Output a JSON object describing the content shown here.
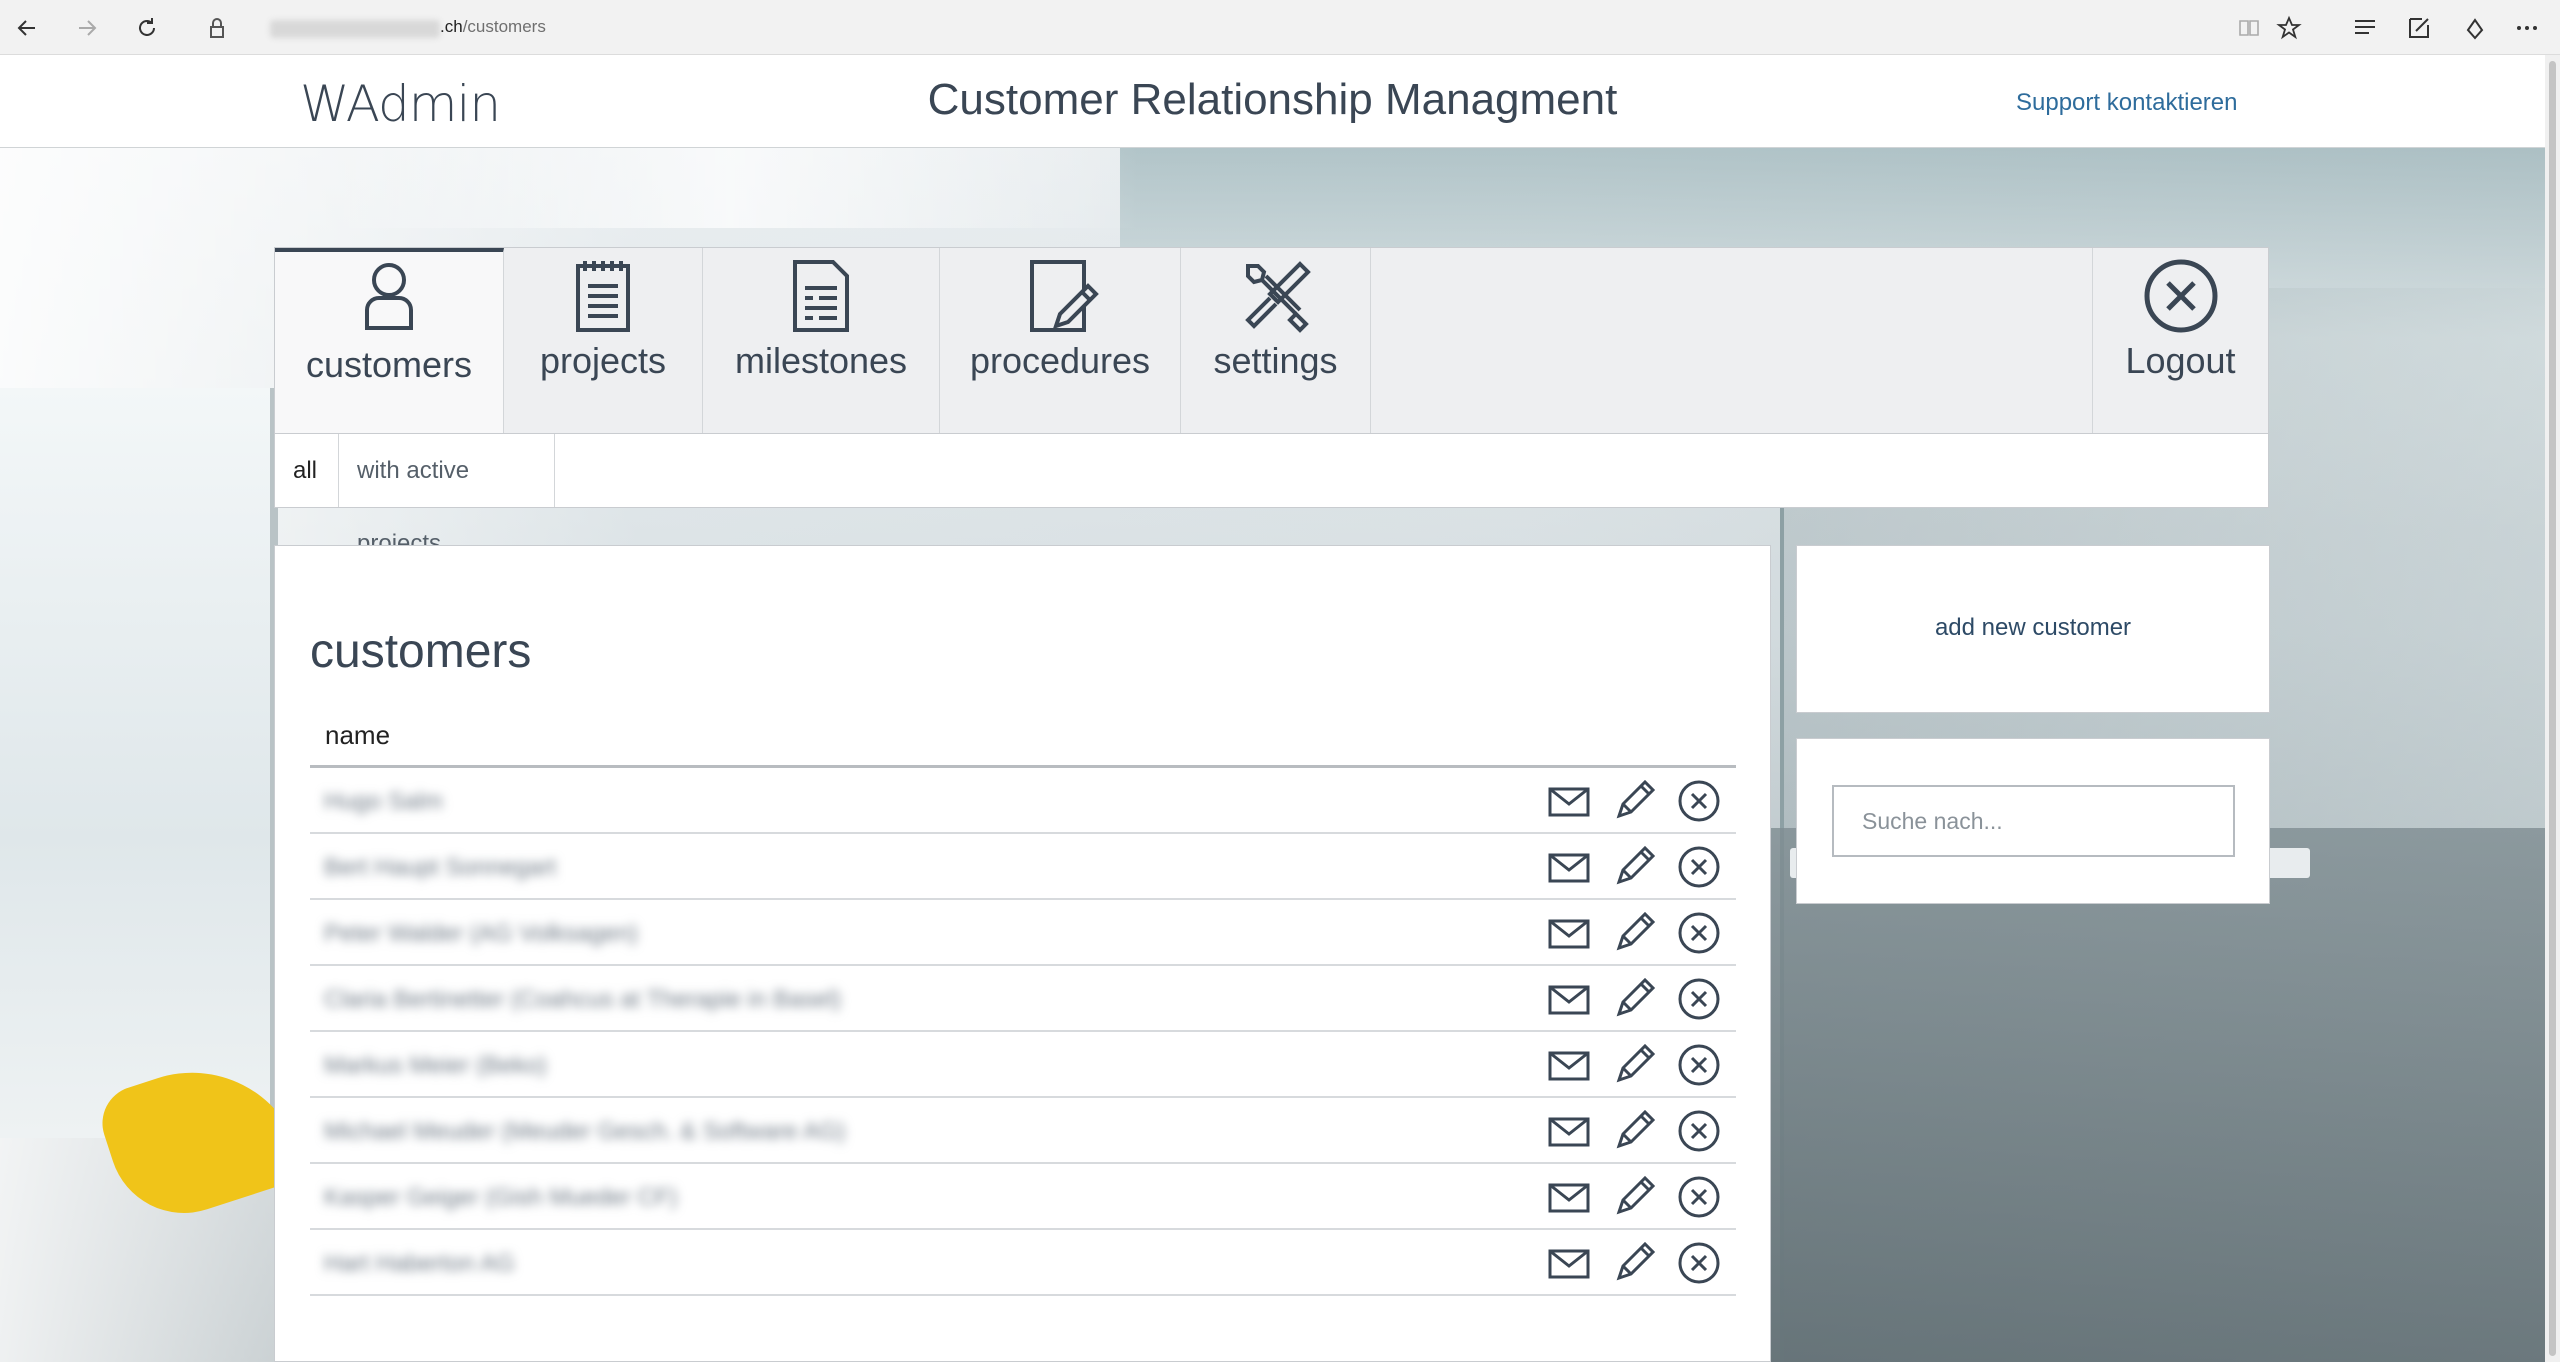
{
  "browser": {
    "url_domain": ".ch",
    "url_path": "/customers",
    "icons": [
      "back-icon",
      "forward-icon",
      "refresh-icon",
      "lock-icon",
      "reading-view-icon",
      "favorite-star-icon",
      "hub-icon",
      "web-note-icon",
      "share-icon",
      "more-icon"
    ]
  },
  "header": {
    "logo": "WAdmin",
    "title": "Customer Relationship Managment",
    "support_link": "Support kontaktieren"
  },
  "tabs": [
    {
      "label": "customers",
      "icon": "person-icon",
      "active": true
    },
    {
      "label": "projects",
      "icon": "clipboard-icon",
      "active": false
    },
    {
      "label": "milestones",
      "icon": "document-list-icon",
      "active": false
    },
    {
      "label": "procedures",
      "icon": "document-pen-icon",
      "active": false
    },
    {
      "label": "settings",
      "icon": "wrench-screwdriver-icon",
      "active": false
    }
  ],
  "logout": {
    "label": "Logout",
    "icon": "close-circle-icon"
  },
  "subtabs": [
    {
      "label": "all",
      "active": true
    },
    {
      "label": "with active projects",
      "active": false
    }
  ],
  "main": {
    "heading": "customers",
    "column_header": "name",
    "rows": [
      {
        "name": "Hugo Salm"
      },
      {
        "name": "Bert Haupt Sonnegart"
      },
      {
        "name": "Peter Walder (AG Volksagen)"
      },
      {
        "name": "Claria Bertinetter (Coahcus at Therapie in Basel)"
      },
      {
        "name": "Markus Meier (Beko)"
      },
      {
        "name": "Michael Meuder (Meuder Gesch. & Software AG)"
      },
      {
        "name": "Kasper Geiger (Gish Mueder CF)"
      },
      {
        "name": "Hart Haberton AG"
      }
    ],
    "row_action_icons": [
      "mail-icon",
      "edit-pencil-icon",
      "delete-circle-icon"
    ]
  },
  "sidebar": {
    "add_new": "add new customer",
    "search_placeholder": "Suche nach..."
  },
  "colors": {
    "primary_text": "#3a4654",
    "link": "#2e6c9c",
    "panel_bg": "#ffffff",
    "tab_bg": "#eeeff1"
  }
}
